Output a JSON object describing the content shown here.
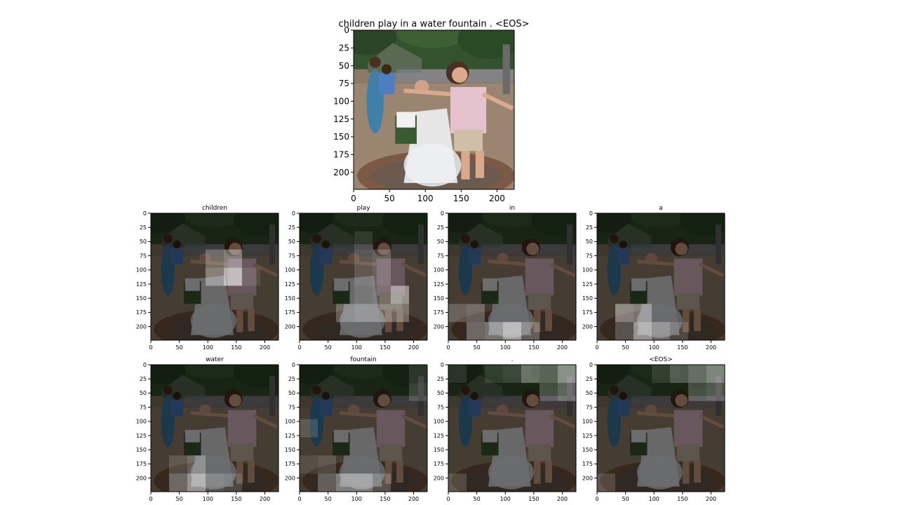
{
  "caption": "children play in a water fountain . <EOS>",
  "colors": {
    "sky": "#3f5a3a",
    "trees": "#2f4a2c",
    "ground": "#8a7560",
    "pavement": "#9d8670",
    "fountain_water": "#f2f4f6",
    "girl_shirt": "#e9c6d2",
    "girl_shorts": "#c9b8a2",
    "skin": "#d9a98b",
    "hair": "#4a3020",
    "dark_overlay": "#000000",
    "attention_highlight": "#ffffff"
  },
  "chart_data": [
    {
      "type": "heatmap",
      "title": "children play in a water fountain . <EOS>",
      "xlim": [
        0,
        224
      ],
      "ylim": [
        224,
        0
      ],
      "xticks": [
        0,
        50,
        100,
        150,
        200
      ],
      "yticks": [
        0,
        25,
        50,
        75,
        100,
        125,
        150,
        175,
        200
      ],
      "grid": false,
      "attention": null
    },
    {
      "type": "heatmap",
      "title": "children",
      "xlim": [
        0,
        224
      ],
      "ylim": [
        224,
        0
      ],
      "xticks": [
        0,
        50,
        100,
        150,
        200
      ],
      "yticks": [
        0,
        25,
        50,
        75,
        100,
        125,
        150,
        175,
        200
      ],
      "grid": false,
      "attention": [
        [
          0,
          0,
          0,
          0,
          0,
          0,
          0
        ],
        [
          0,
          0,
          0,
          0,
          0,
          0,
          0
        ],
        [
          0,
          0,
          0,
          0.25,
          0.35,
          0,
          0
        ],
        [
          0,
          0,
          0,
          0.35,
          0.6,
          0.1,
          0
        ],
        [
          0,
          0,
          0,
          0,
          0,
          0,
          0
        ],
        [
          0,
          0,
          0,
          0,
          0,
          0,
          0
        ],
        [
          0,
          0,
          0,
          0,
          0,
          0,
          0
        ]
      ]
    },
    {
      "type": "heatmap",
      "title": "play",
      "xlim": [
        0,
        224
      ],
      "ylim": [
        224,
        0
      ],
      "xticks": [
        0,
        50,
        100,
        150,
        200
      ],
      "yticks": [
        0,
        25,
        50,
        75,
        100,
        125,
        150,
        175,
        200
      ],
      "grid": false,
      "attention": [
        [
          0,
          0,
          0,
          0,
          0,
          0,
          0
        ],
        [
          0,
          0,
          0,
          0.1,
          0,
          0,
          0
        ],
        [
          0,
          0,
          0,
          0.15,
          0.2,
          0,
          0
        ],
        [
          0,
          0,
          0,
          0.15,
          0.2,
          0,
          0
        ],
        [
          0,
          0,
          0,
          0.1,
          0.15,
          0.45,
          0
        ],
        [
          0,
          0,
          0.25,
          0.3,
          0.3,
          0.3,
          0
        ],
        [
          0,
          0,
          0,
          0,
          0,
          0,
          0
        ]
      ]
    },
    {
      "type": "heatmap",
      "title": "in",
      "xlim": [
        0,
        224
      ],
      "ylim": [
        224,
        0
      ],
      "xticks": [
        0,
        50,
        100,
        150,
        200
      ],
      "yticks": [
        0,
        25,
        50,
        75,
        100,
        125,
        150,
        175,
        200
      ],
      "grid": false,
      "attention": [
        [
          0,
          0,
          0,
          0,
          0,
          0,
          0
        ],
        [
          0,
          0,
          0,
          0,
          0,
          0,
          0
        ],
        [
          0,
          0,
          0,
          0,
          0,
          0,
          0
        ],
        [
          0,
          0,
          0,
          0,
          0,
          0,
          0
        ],
        [
          0,
          0,
          0,
          0,
          0,
          0,
          0
        ],
        [
          0.2,
          0.25,
          0,
          0,
          0,
          0,
          0
        ],
        [
          0,
          0.3,
          0.35,
          0.55,
          0.25,
          0,
          0
        ]
      ]
    },
    {
      "type": "heatmap",
      "title": "a",
      "xlim": [
        0,
        224
      ],
      "ylim": [
        224,
        0
      ],
      "xticks": [
        0,
        50,
        100,
        150,
        200
      ],
      "yticks": [
        0,
        25,
        50,
        75,
        100,
        125,
        150,
        175,
        200
      ],
      "grid": false,
      "attention": [
        [
          0,
          0,
          0,
          0,
          0,
          0,
          0
        ],
        [
          0,
          0,
          0,
          0,
          0,
          0,
          0
        ],
        [
          0,
          0,
          0,
          0,
          0,
          0,
          0
        ],
        [
          0,
          0,
          0,
          0,
          0,
          0,
          0
        ],
        [
          0,
          0,
          0,
          0,
          0,
          0,
          0
        ],
        [
          0,
          0.4,
          0.35,
          0,
          0,
          0,
          0
        ],
        [
          0,
          0.2,
          0.5,
          0.3,
          0.15,
          0,
          0
        ]
      ]
    },
    {
      "type": "heatmap",
      "title": "water",
      "xlim": [
        0,
        224
      ],
      "ylim": [
        224,
        0
      ],
      "xticks": [
        0,
        50,
        100,
        150,
        200
      ],
      "yticks": [
        0,
        25,
        50,
        75,
        100,
        125,
        150,
        175,
        200
      ],
      "grid": false,
      "attention": [
        [
          0,
          0,
          0,
          0,
          0,
          0,
          0
        ],
        [
          0,
          0,
          0,
          0,
          0,
          0,
          0
        ],
        [
          0,
          0,
          0,
          0,
          0,
          0,
          0
        ],
        [
          0,
          0,
          0,
          0,
          0,
          0,
          0
        ],
        [
          0,
          0,
          0,
          0,
          0,
          0,
          0
        ],
        [
          0,
          0.15,
          0.25,
          0,
          0,
          0,
          0
        ],
        [
          0,
          0.3,
          0.5,
          0.2,
          0.15,
          0,
          0
        ]
      ]
    },
    {
      "type": "heatmap",
      "title": "fountain",
      "xlim": [
        0,
        224
      ],
      "ylim": [
        224,
        0
      ],
      "xticks": [
        0,
        50,
        100,
        150,
        200
      ],
      "yticks": [
        0,
        25,
        50,
        75,
        100,
        125,
        150,
        175,
        200
      ],
      "grid": false,
      "attention": [
        [
          0,
          0,
          0,
          0,
          0,
          0,
          0.1
        ],
        [
          0,
          0,
          0,
          0,
          0,
          0,
          0.15
        ],
        [
          0,
          0,
          0,
          0,
          0,
          0,
          0
        ],
        [
          0.15,
          0,
          0,
          0,
          0,
          0,
          0
        ],
        [
          0,
          0,
          0,
          0,
          0,
          0,
          0
        ],
        [
          0.1,
          0.15,
          0,
          0,
          0,
          0,
          0
        ],
        [
          0,
          0.25,
          0.4,
          0.4,
          0.2,
          0,
          0
        ]
      ]
    },
    {
      "type": "heatmap",
      "title": ".",
      "xlim": [
        0,
        224
      ],
      "ylim": [
        224,
        0
      ],
      "xticks": [
        0,
        50,
        100,
        150,
        200
      ],
      "yticks": [
        0,
        25,
        50,
        75,
        100,
        125,
        150,
        175,
        200
      ],
      "grid": false,
      "attention": [
        [
          0.1,
          0,
          0.1,
          0.15,
          0.35,
          0.3,
          0.5
        ],
        [
          0,
          0,
          0,
          0,
          0,
          0.2,
          0.3
        ],
        [
          0,
          0,
          0,
          0,
          0,
          0,
          0
        ],
        [
          0,
          0,
          0,
          0,
          0,
          0,
          0
        ],
        [
          0,
          0,
          0,
          0,
          0,
          0,
          0
        ],
        [
          0,
          0,
          0,
          0,
          0,
          0,
          0
        ],
        [
          0.15,
          0,
          0,
          0,
          0,
          0,
          0
        ]
      ]
    },
    {
      "type": "heatmap",
      "title": "<EOS>",
      "xlim": [
        0,
        224
      ],
      "ylim": [
        224,
        0
      ],
      "xticks": [
        0,
        50,
        100,
        150,
        200
      ],
      "yticks": [
        0,
        25,
        50,
        75,
        100,
        125,
        150,
        175,
        200
      ],
      "grid": false,
      "attention": [
        [
          0,
          0,
          0,
          0.1,
          0.25,
          0.35,
          0.45
        ],
        [
          0,
          0,
          0,
          0,
          0,
          0.2,
          0.25
        ],
        [
          0,
          0,
          0,
          0,
          0,
          0,
          0
        ],
        [
          0,
          0,
          0,
          0,
          0,
          0,
          0
        ],
        [
          0,
          0,
          0,
          0,
          0,
          0,
          0
        ],
        [
          0,
          0,
          0,
          0,
          0,
          0,
          0
        ],
        [
          0.15,
          0,
          0,
          0,
          0,
          0,
          0
        ]
      ]
    }
  ]
}
